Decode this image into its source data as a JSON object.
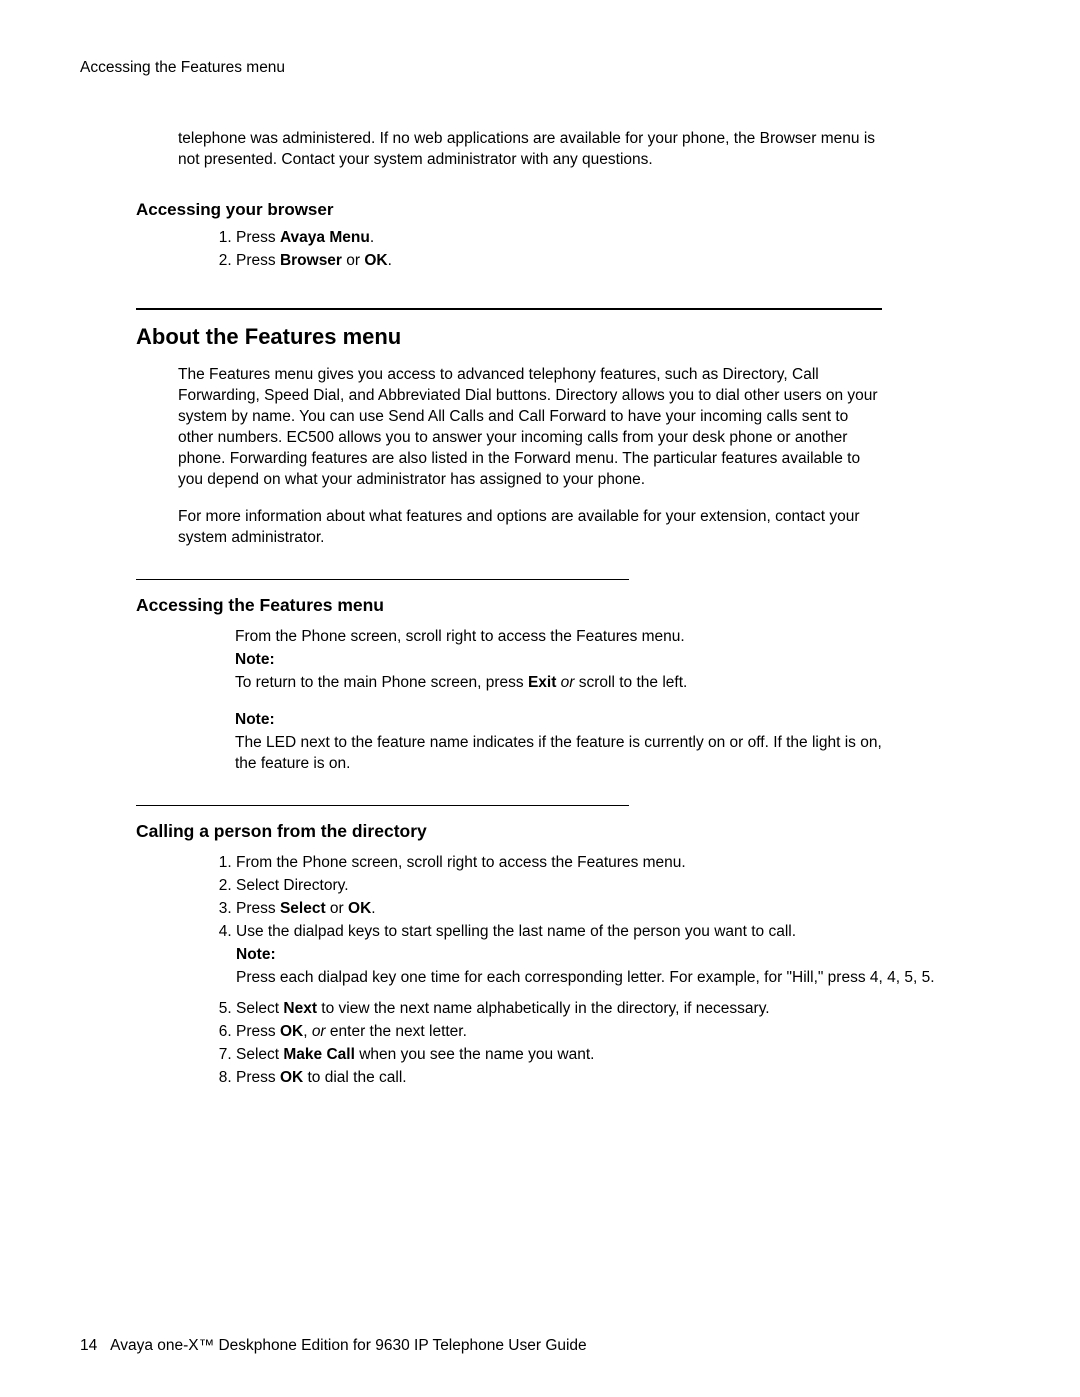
{
  "header": "Accessing the Features menu",
  "intro_para": "telephone was administered. If no web applications are available for your phone, the Browser menu is not presented. Contact your system administrator with any questions.",
  "browser": {
    "heading": "Accessing your browser",
    "step1_pre": "Press ",
    "step1_b": "Avaya Menu",
    "step1_post": ".",
    "step2_pre": "Press ",
    "step2_b1": "Browser",
    "step2_mid": " or ",
    "step2_b2": "OK",
    "step2_post": "."
  },
  "about": {
    "heading": "About the Features menu",
    "p1": "The Features menu gives you access to advanced telephony features, such as Directory, Call Forwarding, Speed Dial, and Abbreviated Dial buttons. Directory allows you to dial other users on your system by name. You can use Send All Calls and Call Forward to have your incoming calls sent to other numbers. EC500 allows you to answer your incoming calls from your desk phone or another phone. Forwarding features are also listed in the Forward menu. The particular features available to you depend on what your administrator has assigned to your phone.",
    "p2": "For more information about what features and options are available for your extension, contact your system administrator."
  },
  "accessFeatures": {
    "heading": "Accessing the Features menu",
    "line1": "From the Phone screen, scroll right to access the Features menu.",
    "noteLabel1": "Note:",
    "note1_pre": "To return to the main Phone screen, press ",
    "note1_b": "Exit",
    "note1_i": " or",
    "note1_post": " scroll to the left.",
    "noteLabel2": "Note:",
    "note2": "The LED next to the feature name indicates if the feature is currently on or off. If the light is on, the feature is on."
  },
  "calling": {
    "heading": "Calling a person from the directory",
    "s1": "From the Phone screen, scroll right to access the Features menu.",
    "s2": "Select Directory.",
    "s3_pre": "Press ",
    "s3_b1": "Select",
    "s3_mid": " or ",
    "s3_b2": "OK",
    "s3_post": ".",
    "s4": "Use the dialpad keys to start spelling the last name of the person you want to call.",
    "s4_noteLabel": "Note:",
    "s4_noteText": "Press each dialpad key one time for each corresponding letter. For example, for \"Hill,\" press 4, 4, 5, 5.",
    "s5_pre": "Select ",
    "s5_b": "Next",
    "s5_post": " to view the next name alphabetically in the directory, if necessary.",
    "s6_pre": "Press ",
    "s6_b": "OK",
    "s6_mid": ", ",
    "s6_i": "or",
    "s6_post": " enter the next letter.",
    "s7_pre": "Select ",
    "s7_b": "Make Call",
    "s7_post": " when you see the name you want.",
    "s8_pre": "Press ",
    "s8_b": "OK",
    "s8_post": " to dial the call."
  },
  "footer": {
    "pageNum": "14",
    "text": "Avaya one-X™ Deskphone Edition  for 9630 IP Telephone User Guide"
  }
}
